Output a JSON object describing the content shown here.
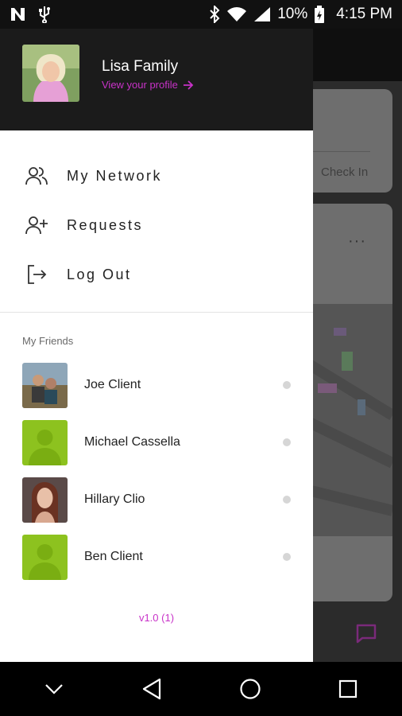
{
  "status_bar": {
    "left_icons": [
      "n-logo-icon",
      "usb-icon"
    ],
    "right_icons": [
      "bluetooth-icon",
      "wifi-icon",
      "signal-icon",
      "battery-icon"
    ],
    "battery": "10%",
    "time": "4:15 PM"
  },
  "background": {
    "card_action": "Check In",
    "menu_dots": "···"
  },
  "drawer": {
    "profile": {
      "name": "Lisa Family",
      "link": "View your profile",
      "link_icon": "arrow-right-icon"
    },
    "menu": [
      {
        "label": "My Network",
        "icon": "users-icon"
      },
      {
        "label": "Requests",
        "icon": "add-user-icon"
      },
      {
        "label": "Log Out",
        "icon": "logout-icon"
      }
    ],
    "friends_title": "My Friends",
    "friends": [
      {
        "name": "Joe Client"
      },
      {
        "name": "Michael Cassella"
      },
      {
        "name": "Hillary Clio"
      },
      {
        "name": "Ben Client"
      }
    ],
    "version": "v1.0 (1)"
  },
  "colors": {
    "accent": "#c832c8",
    "drawer_header": "#1b1b1b",
    "placeholder_avatar": "#8dc21f"
  },
  "nav_bar": [
    "chevron-down-icon",
    "back-triangle-icon",
    "home-circle-icon",
    "recents-square-icon"
  ]
}
